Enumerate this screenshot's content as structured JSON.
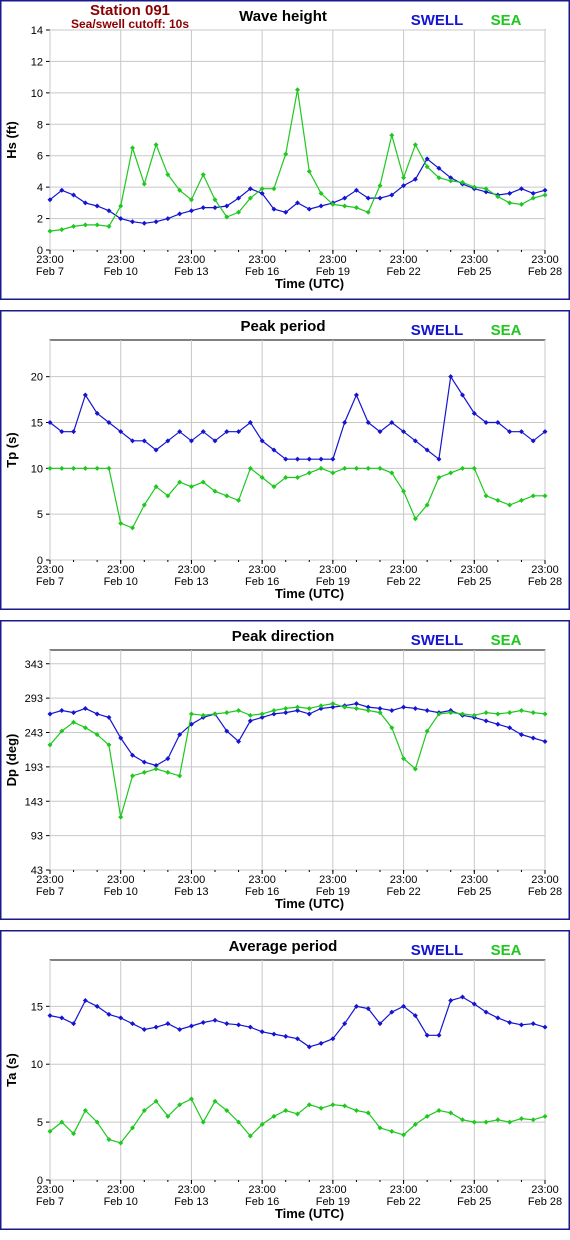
{
  "station": {
    "name": "Station 091",
    "cutoff": "Sea/swell cutoff: 10s"
  },
  "legend": {
    "swell_label": "SWELL",
    "sea_label": "SEA"
  },
  "colors": {
    "swell": "#1414d2",
    "sea": "#1ec81e",
    "frame": "#1a1a8c",
    "grid": "#c8c8c8",
    "station": "#8b0000"
  },
  "xaxis": {
    "label": "Time (UTC)",
    "tick_times": [
      "23:00",
      "23:00",
      "23:00",
      "23:00",
      "23:00",
      "23:00",
      "23:00",
      "23:00"
    ],
    "tick_dates": [
      "Feb 7",
      "Feb 10",
      "Feb 13",
      "Feb 16",
      "Feb 19",
      "Feb 22",
      "Feb 25",
      "Feb 28"
    ]
  },
  "chart_data": [
    {
      "type": "scatter",
      "title": "Wave height",
      "ylabel": "Hs (ft)",
      "xlabel": "Time (UTC)",
      "ylim": [
        0,
        14
      ],
      "yticks": [
        "0",
        "2",
        "4",
        "6",
        "8",
        "10",
        "12",
        "14"
      ],
      "xlim": [
        0,
        21
      ],
      "series": [
        {
          "name": "SWELL",
          "x": [
            0,
            0.5,
            1,
            1.5,
            2,
            2.5,
            3,
            3.5,
            4,
            4.5,
            5,
            5.5,
            6,
            6.5,
            7,
            7.5,
            8,
            8.5,
            9,
            9.5,
            10,
            10.5,
            11,
            11.5,
            12,
            12.5,
            13,
            13.5,
            14,
            14.5,
            15,
            15.5,
            16,
            16.5,
            17,
            17.5,
            18,
            18.5,
            19,
            19.5,
            20,
            20.5,
            21
          ],
          "values": [
            3.2,
            3.8,
            3.5,
            3.0,
            2.8,
            2.5,
            2.0,
            1.8,
            1.7,
            1.8,
            2.0,
            2.3,
            2.5,
            2.7,
            2.7,
            2.8,
            3.3,
            3.9,
            3.6,
            2.6,
            2.4,
            3.0,
            2.6,
            2.8,
            3.0,
            3.3,
            3.8,
            3.3,
            3.3,
            3.5,
            4.1,
            4.5,
            5.8,
            5.2,
            4.6,
            4.2,
            3.9,
            3.7,
            3.5,
            3.6,
            3.9,
            3.6,
            3.8
          ]
        },
        {
          "name": "SEA",
          "x": [
            0,
            0.5,
            1,
            1.5,
            2,
            2.5,
            3,
            3.5,
            4,
            4.5,
            5,
            5.5,
            6,
            6.5,
            7,
            7.5,
            8,
            8.5,
            9,
            9.5,
            10,
            10.5,
            11,
            11.5,
            12,
            12.5,
            13,
            13.5,
            14,
            14.5,
            15,
            15.5,
            16,
            16.5,
            17,
            17.5,
            18,
            18.5,
            19,
            19.5,
            20,
            20.5,
            21
          ],
          "values": [
            1.2,
            1.3,
            1.5,
            1.6,
            1.6,
            1.5,
            2.8,
            6.5,
            4.2,
            6.7,
            4.8,
            3.8,
            3.2,
            4.8,
            3.2,
            2.1,
            2.4,
            3.3,
            3.9,
            3.9,
            6.1,
            10.2,
            5.0,
            3.6,
            2.9,
            2.8,
            2.7,
            2.4,
            4.1,
            7.3,
            4.6,
            6.7,
            5.3,
            4.6,
            4.4,
            4.3,
            4.0,
            3.9,
            3.4,
            3.0,
            2.9,
            3.3,
            3.5
          ]
        }
      ]
    },
    {
      "type": "scatter",
      "title": "Peak period",
      "ylabel": "Tp (s)",
      "xlabel": "Time (UTC)",
      "ylim": [
        0,
        24
      ],
      "yticks": [
        "0",
        "5",
        "10",
        "15",
        "20"
      ],
      "xlim": [
        0,
        21
      ],
      "series": [
        {
          "name": "SWELL",
          "x": [
            0,
            0.5,
            1,
            1.5,
            2,
            2.5,
            3,
            3.5,
            4,
            4.5,
            5,
            5.5,
            6,
            6.5,
            7,
            7.5,
            8,
            8.5,
            9,
            9.5,
            10,
            10.5,
            11,
            11.5,
            12,
            12.5,
            13,
            13.5,
            14,
            14.5,
            15,
            15.5,
            16,
            16.5,
            17,
            17.5,
            18,
            18.5,
            19,
            19.5,
            20,
            20.5,
            21
          ],
          "values": [
            15,
            14,
            14,
            18,
            16,
            15,
            14,
            13,
            13,
            12,
            13,
            14,
            13,
            14,
            13,
            14,
            14,
            15,
            13,
            12,
            11,
            11,
            11,
            11,
            11,
            15,
            18,
            15,
            14,
            15,
            14,
            13,
            12,
            11,
            20,
            18,
            16,
            15,
            15,
            14,
            14,
            13,
            14
          ]
        },
        {
          "name": "SEA",
          "x": [
            0,
            0.5,
            1,
            1.5,
            2,
            2.5,
            3,
            3.5,
            4,
            4.5,
            5,
            5.5,
            6,
            6.5,
            7,
            7.5,
            8,
            8.5,
            9,
            9.5,
            10,
            10.5,
            11,
            11.5,
            12,
            12.5,
            13,
            13.5,
            14,
            14.5,
            15,
            15.5,
            16,
            16.5,
            17,
            17.5,
            18,
            18.5,
            19,
            19.5,
            20,
            20.5,
            21
          ],
          "values": [
            10,
            10,
            10,
            10,
            10,
            10,
            4,
            3.5,
            6,
            8,
            7,
            8.5,
            8,
            8.5,
            7.5,
            7,
            6.5,
            10,
            9,
            8,
            9,
            9,
            9.5,
            10,
            9.5,
            10,
            10,
            10,
            10,
            9.5,
            7.5,
            4.5,
            6,
            9,
            9.5,
            10,
            10,
            7,
            6.5,
            6,
            6.5,
            7,
            7
          ]
        }
      ]
    },
    {
      "type": "scatter",
      "title": "Peak direction",
      "ylabel": "Dp (deg)",
      "xlabel": "Time (UTC)",
      "ylim": [
        43,
        363
      ],
      "yticks": [
        "43",
        "93",
        "143",
        "193",
        "243",
        "293",
        "343"
      ],
      "xlim": [
        0,
        21
      ],
      "series": [
        {
          "name": "SWELL",
          "x": [
            0,
            0.5,
            1,
            1.5,
            2,
            2.5,
            3,
            3.5,
            4,
            4.5,
            5,
            5.5,
            6,
            6.5,
            7,
            7.5,
            8,
            8.5,
            9,
            9.5,
            10,
            10.5,
            11,
            11.5,
            12,
            12.5,
            13,
            13.5,
            14,
            14.5,
            15,
            15.5,
            16,
            16.5,
            17,
            17.5,
            18,
            18.5,
            19,
            19.5,
            20,
            20.5,
            21
          ],
          "values": [
            270,
            275,
            272,
            278,
            270,
            265,
            235,
            210,
            200,
            195,
            205,
            240,
            255,
            265,
            270,
            245,
            230,
            260,
            265,
            270,
            272,
            275,
            270,
            278,
            280,
            282,
            285,
            280,
            278,
            275,
            280,
            278,
            275,
            272,
            275,
            268,
            265,
            260,
            255,
            250,
            240,
            235,
            230
          ]
        },
        {
          "name": "SEA",
          "x": [
            0,
            0.5,
            1,
            1.5,
            2,
            2.5,
            3,
            3.5,
            4,
            4.5,
            5,
            5.5,
            6,
            6.5,
            7,
            7.5,
            8,
            8.5,
            9,
            9.5,
            10,
            10.5,
            11,
            11.5,
            12,
            12.5,
            13,
            13.5,
            14,
            14.5,
            15,
            15.5,
            16,
            16.5,
            17,
            17.5,
            18,
            18.5,
            19,
            19.5,
            20,
            20.5,
            21
          ],
          "values": [
            225,
            245,
            258,
            250,
            240,
            225,
            120,
            180,
            185,
            190,
            185,
            180,
            270,
            268,
            270,
            272,
            275,
            268,
            270,
            275,
            278,
            280,
            278,
            282,
            285,
            280,
            278,
            275,
            272,
            250,
            205,
            190,
            245,
            270,
            272,
            270,
            268,
            272,
            270,
            272,
            275,
            272,
            270
          ]
        }
      ]
    },
    {
      "type": "scatter",
      "title": "Average period",
      "ylabel": "Ta (s)",
      "xlabel": "Time (UTC)",
      "ylim": [
        0,
        19
      ],
      "yticks": [
        "0",
        "5",
        "10",
        "15"
      ],
      "xlim": [
        0,
        21
      ],
      "series": [
        {
          "name": "SWELL",
          "x": [
            0,
            0.5,
            1,
            1.5,
            2,
            2.5,
            3,
            3.5,
            4,
            4.5,
            5,
            5.5,
            6,
            6.5,
            7,
            7.5,
            8,
            8.5,
            9,
            9.5,
            10,
            10.5,
            11,
            11.5,
            12,
            12.5,
            13,
            13.5,
            14,
            14.5,
            15,
            15.5,
            16,
            16.5,
            17,
            17.5,
            18,
            18.5,
            19,
            19.5,
            20,
            20.5,
            21
          ],
          "values": [
            14.2,
            14,
            13.5,
            15.5,
            15,
            14.3,
            14,
            13.5,
            13,
            13.2,
            13.5,
            13,
            13.3,
            13.6,
            13.8,
            13.5,
            13.4,
            13.2,
            12.8,
            12.6,
            12.4,
            12.2,
            11.5,
            11.8,
            12.2,
            13.5,
            15,
            14.8,
            13.5,
            14.5,
            15,
            14.2,
            12.5,
            12.5,
            15.5,
            15.8,
            15.2,
            14.5,
            14,
            13.6,
            13.4,
            13.5,
            13.2
          ]
        },
        {
          "name": "SEA",
          "x": [
            0,
            0.5,
            1,
            1.5,
            2,
            2.5,
            3,
            3.5,
            4,
            4.5,
            5,
            5.5,
            6,
            6.5,
            7,
            7.5,
            8,
            8.5,
            9,
            9.5,
            10,
            10.5,
            11,
            11.5,
            12,
            12.5,
            13,
            13.5,
            14,
            14.5,
            15,
            15.5,
            16,
            16.5,
            17,
            17.5,
            18,
            18.5,
            19,
            19.5,
            20,
            20.5,
            21
          ],
          "values": [
            4.2,
            5,
            4,
            6,
            5,
            3.5,
            3.2,
            4.5,
            6,
            6.8,
            5.5,
            6.5,
            7,
            5,
            6.8,
            6,
            5,
            3.8,
            4.8,
            5.5,
            6,
            5.7,
            6.5,
            6.2,
            6.5,
            6.4,
            6,
            5.8,
            4.5,
            4.2,
            3.9,
            4.8,
            5.5,
            6,
            5.8,
            5.2,
            5,
            5,
            5.2,
            5,
            5.3,
            5.2,
            5.5
          ]
        }
      ]
    }
  ]
}
